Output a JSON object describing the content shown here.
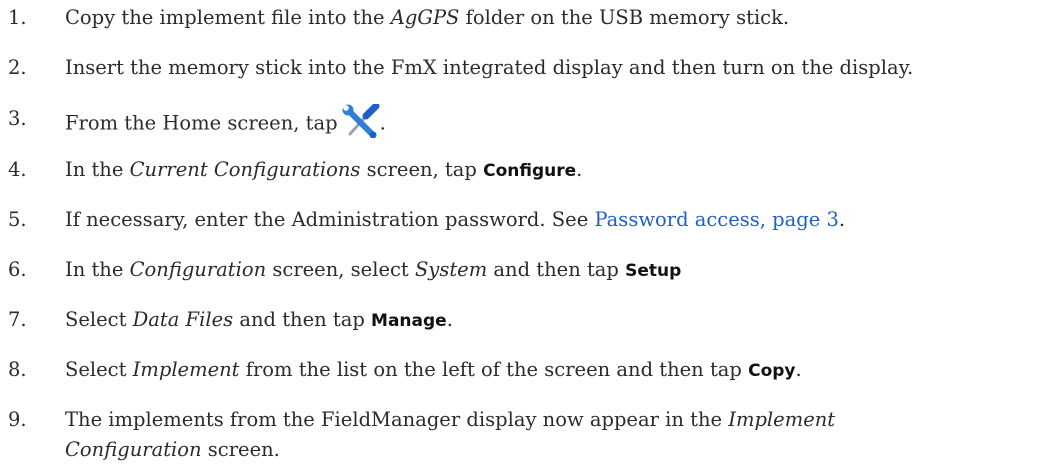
{
  "steps": [
    {
      "num": "1.",
      "parts": [
        "Copy the implement file into the ",
        "AgGPS",
        " folder on the USB memory stick."
      ]
    },
    {
      "num": "2.",
      "parts": [
        "Insert the memory stick into the FmX integrated display and then turn on the display."
      ]
    },
    {
      "num": "3.",
      "parts": [
        "From the Home screen, tap",
        "."
      ],
      "icon": "wrench-screwdriver-icon"
    },
    {
      "num": "4.",
      "parts": [
        "In the ",
        "Current Configurations",
        " screen, tap ",
        "Configure",
        "."
      ]
    },
    {
      "num": "5.",
      "parts": [
        "If necessary, enter the Administration password. See ",
        "Password access, page 3",
        "."
      ]
    },
    {
      "num": "6.",
      "parts": [
        "In the ",
        "Configuration",
        " screen, select ",
        "System",
        " and then tap ",
        "Setup"
      ]
    },
    {
      "num": "7.",
      "parts": [
        "Select ",
        "Data Files",
        " and then tap ",
        "Manage",
        "."
      ]
    },
    {
      "num": "8.",
      "parts": [
        "Select ",
        "Implement",
        " from the list on the left of the screen and then tap ",
        "Copy",
        "."
      ]
    },
    {
      "num": "9.",
      "parts": [
        "The implements from the FieldManager display now appear in the ",
        "Implement Configuration",
        " screen."
      ]
    }
  ],
  "colors": {
    "text": "#2b2b2b",
    "link": "#1f5fc6",
    "icon_blue": "#2f7fd8",
    "icon_metal": "#9aa3ad"
  }
}
